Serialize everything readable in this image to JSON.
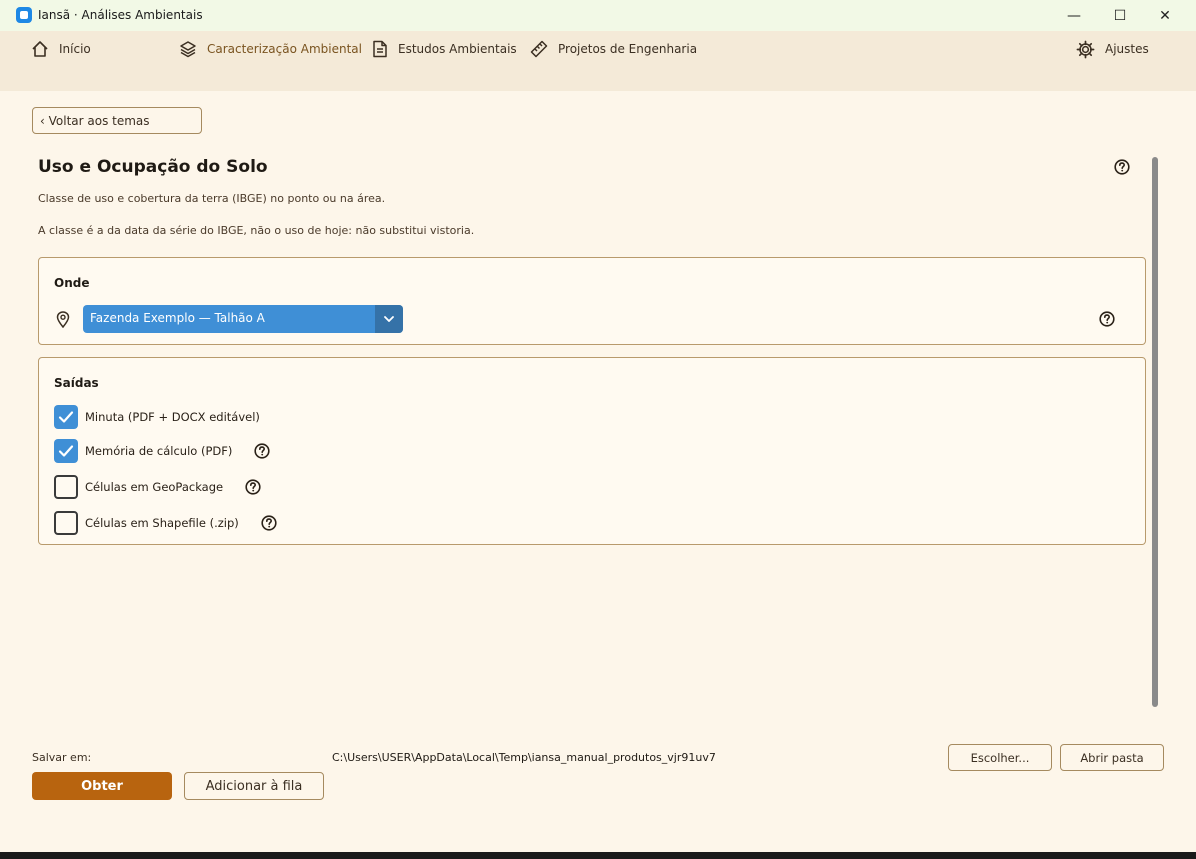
{
  "window": {
    "title": "Iansã · Análises Ambientais",
    "minimize": "—",
    "maximize": "☐",
    "close": "✕"
  },
  "nav": {
    "home": "Início",
    "characterization": "Caracterização Ambiental",
    "studies": "Estudos Ambientais",
    "projects": "Projetos de Engenharia",
    "settings": "Ajustes"
  },
  "back_label": "‹ Voltar aos temas",
  "page": {
    "title": "Uso e Ocupação do Solo",
    "desc1": "Classe de uso e cobertura da terra (IBGE) no ponto ou na área.",
    "desc2": "A classe é a da data da série do IBGE, não o uso de hoje: não substitui vistoria."
  },
  "onde": {
    "title": "Onde",
    "selected": "Fazenda Exemplo — Talhão A"
  },
  "saidas": {
    "title": "Saídas",
    "items": [
      {
        "label": "Minuta (PDF + DOCX editável)",
        "checked": true
      },
      {
        "label": "Memória de cálculo (PDF)",
        "checked": true
      },
      {
        "label": "Células em GeoPackage",
        "checked": false
      },
      {
        "label": "Células em Shapefile (.zip)",
        "checked": false
      }
    ]
  },
  "footer": {
    "save_label": "Salvar em:",
    "save_path": "C:\\Users\\USER\\AppData\\Local\\Temp\\iansa_manual_produtos_vjr91uv7",
    "choose": "Escolher...",
    "open_folder": "Abrir pasta",
    "obtain": "Obter",
    "add_queue": "Adicionar à fila"
  },
  "colors": {
    "accent": "#b8640f",
    "select": "#3f8fd6",
    "panel_border": "#b89a6c",
    "background": "#fdf6ea"
  }
}
